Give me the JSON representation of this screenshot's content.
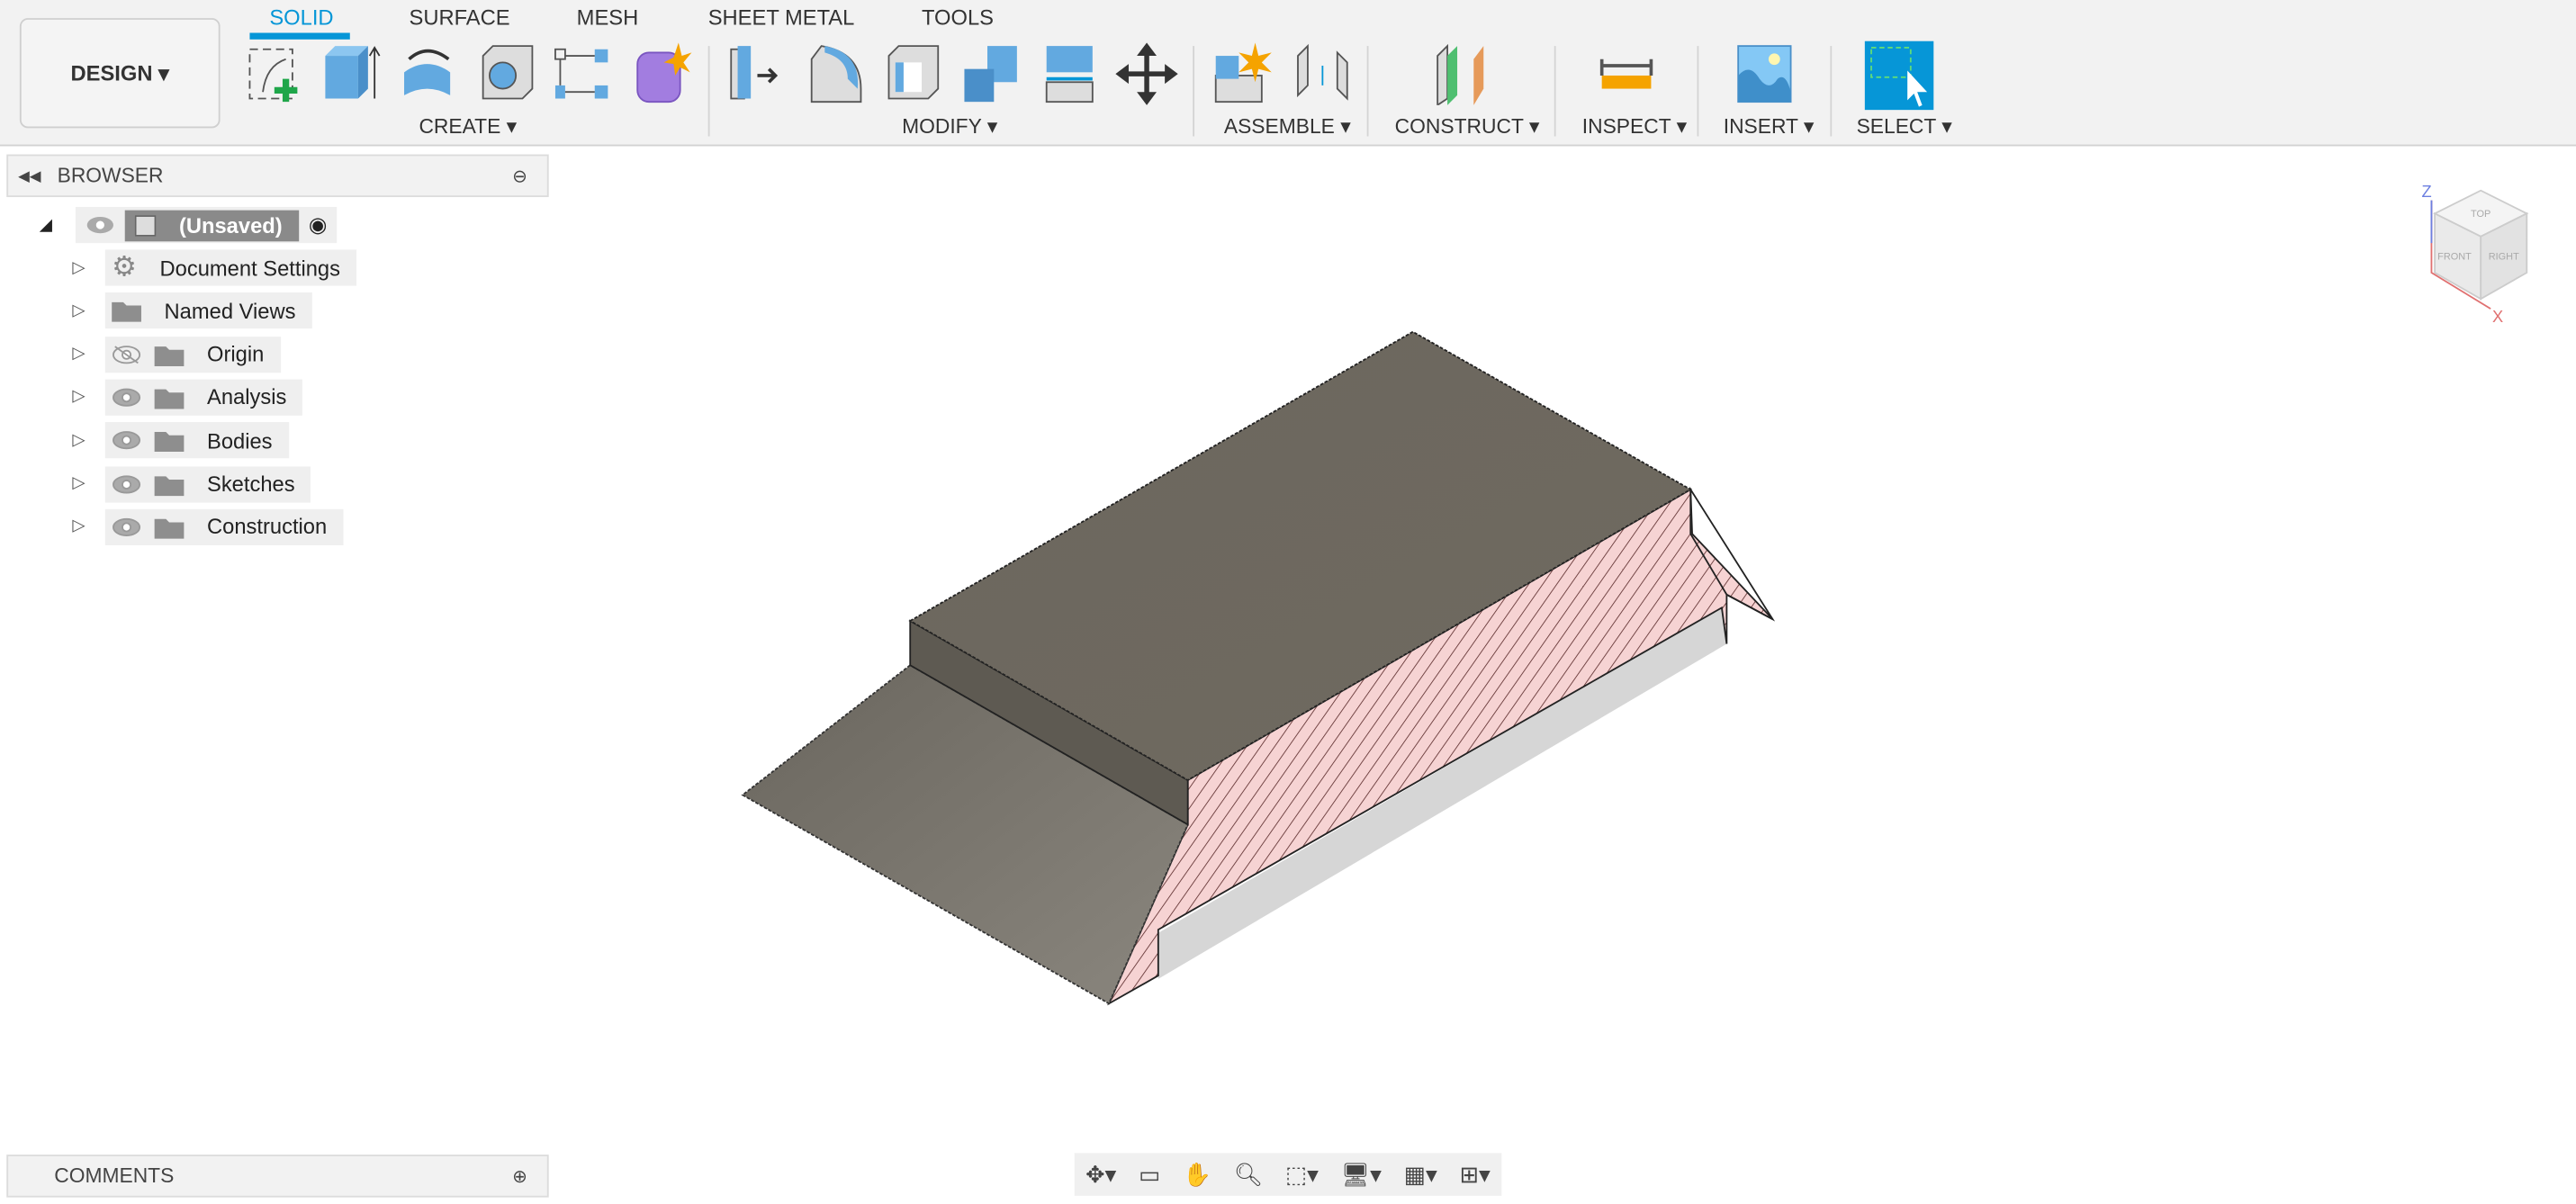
{
  "toolbar": {
    "workspace": "DESIGN",
    "tabs": [
      {
        "label": "SOLID",
        "active": true
      },
      {
        "label": "SURFACE"
      },
      {
        "label": "MESH"
      },
      {
        "label": "SHEET METAL"
      },
      {
        "label": "TOOLS"
      }
    ],
    "groups": [
      "CREATE",
      "MODIFY",
      "ASSEMBLE",
      "CONSTRUCT",
      "INSPECT",
      "INSERT",
      "SELECT"
    ],
    "accent": "#0696d7"
  },
  "browser": {
    "title": "BROWSER",
    "root": "(Unsaved)",
    "items": [
      {
        "label": "Document Settings",
        "icon": "gear-icon"
      },
      {
        "label": "Named Views",
        "icon": "folder-icon"
      },
      {
        "label": "Origin",
        "icon": "folder-icon",
        "hidden": true
      },
      {
        "label": "Analysis",
        "icon": "folder-icon"
      },
      {
        "label": "Bodies",
        "icon": "folder-icon"
      },
      {
        "label": "Sketches",
        "icon": "folder-icon"
      },
      {
        "label": "Construction",
        "icon": "folder-icon"
      }
    ]
  },
  "comments": {
    "title": "COMMENTS"
  },
  "viewcube": {
    "top": "TOP",
    "front": "FRONT",
    "right": "RIGHT",
    "axes": [
      "Z",
      "X"
    ]
  }
}
